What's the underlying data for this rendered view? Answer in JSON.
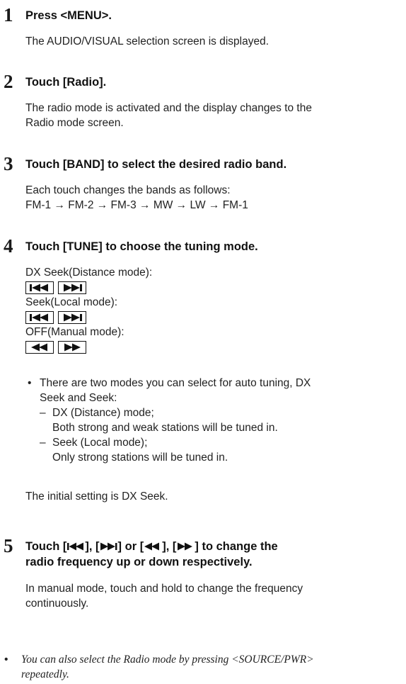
{
  "steps": [
    {
      "number": "1",
      "title": "Press <MENU>.",
      "body": [
        "The AUDIO/VISUAL selection screen is displayed."
      ]
    },
    {
      "number": "2",
      "title": "Touch [Radio].",
      "body": [
        "The radio mode is activated and the display changes to the",
        "Radio mode screen."
      ]
    },
    {
      "number": "3",
      "title": "Touch [BAND] to select the desired radio band.",
      "body": [
        "Each touch changes the bands as follows:",
        "FM-1 → FM-2 → FM-3 → MW → LW → FM-1"
      ]
    },
    {
      "number": "4",
      "title": "Touch [TUNE] to choose the tuning mode.",
      "modes": [
        {
          "label": "DX Seek(Distance mode):"
        },
        {
          "label": "Seek(Local mode):"
        },
        {
          "label": "OFF(Manual mode):"
        }
      ],
      "bullet": {
        "lines": [
          "There are two modes you can select for auto tuning, DX",
          "Seek and Seek:"
        ],
        "subitems": [
          {
            "dash": "–",
            "lines": [
              "DX (Distance) mode;",
              "Both strong and weak stations will be tuned in."
            ]
          },
          {
            "dash": "–",
            "lines": [
              "Seek (Local mode);",
              "Only strong stations will be tuned in."
            ]
          }
        ]
      },
      "initial_setting": "The initial setting is DX Seek."
    },
    {
      "number": "5",
      "title_line1_pre": "Touch [",
      "title_sep1": "], [",
      "title_sep2": "] or [ ",
      "title_sep3": "], [",
      "title_line1_post": " ] to change the",
      "title_line2": "radio frequency up or down respectively.",
      "body": [
        "In manual mode, touch and hold to change the frequency",
        "continuously."
      ]
    }
  ],
  "note": {
    "bullet": "•",
    "lines": [
      "You can also select the Radio mode by pressing <SOURCE/PWR>",
      "repeatedly."
    ]
  },
  "icons": {
    "seek_down": "skip-back-icon",
    "seek_up": "skip-forward-icon",
    "manual_down": "rewind-icon",
    "manual_up": "fast-forward-icon"
  }
}
